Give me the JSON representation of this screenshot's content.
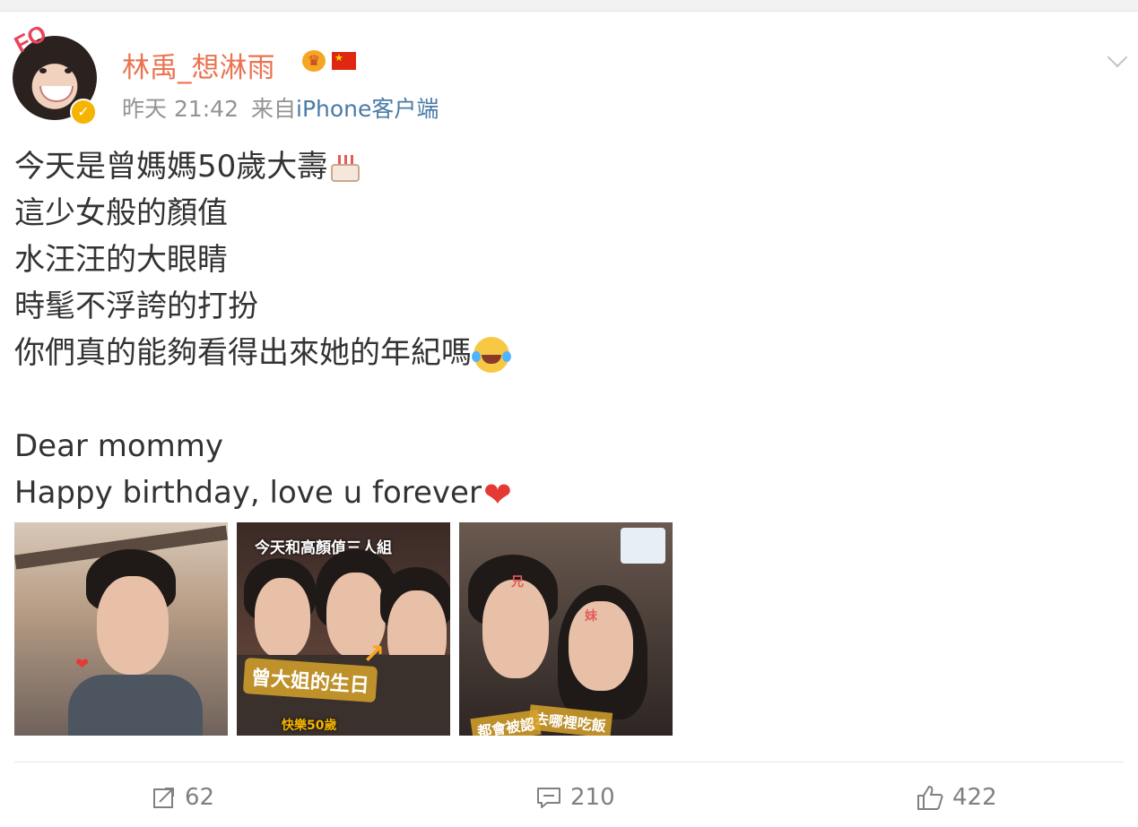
{
  "post": {
    "username": "林禹_想淋雨",
    "time": "昨天 21:42",
    "source_prefix": "来自",
    "source": "iPhone客户端",
    "lines": [
      "今天是曾媽媽50歲大壽",
      "這少女般的顏值",
      "水汪汪的大眼睛",
      "時髦不浮誇的打扮",
      "你們真的能夠看得出來她的年紀嗎",
      "Dear mommy",
      "Happy birthday, love u forever"
    ],
    "avatar_text": "FO",
    "photos": [
      {
        "labels": []
      },
      {
        "labels": [
          "今天和高顏值三人組",
          "曾大姐的生日",
          "快樂50歲"
        ]
      },
      {
        "labels": [
          "兄",
          "妹",
          "去哪裡吃飯",
          "都會被認"
        ]
      }
    ]
  },
  "actions": {
    "repost_count": "62",
    "comment_count": "210",
    "like_count": "422"
  },
  "icons": [
    "verified-badge-icon",
    "crown-badge-icon",
    "china-flag-icon",
    "chevron-down-icon",
    "birthday-cake-emoji",
    "tears-of-joy-emoji",
    "red-heart-emoji",
    "repost-icon",
    "comment-icon",
    "like-icon"
  ],
  "colors": {
    "username": "#eb7350",
    "meta": "#939393",
    "link": "#4a7ba6",
    "text": "#333333",
    "verified": "#f5b400",
    "heart": "#e53935"
  }
}
